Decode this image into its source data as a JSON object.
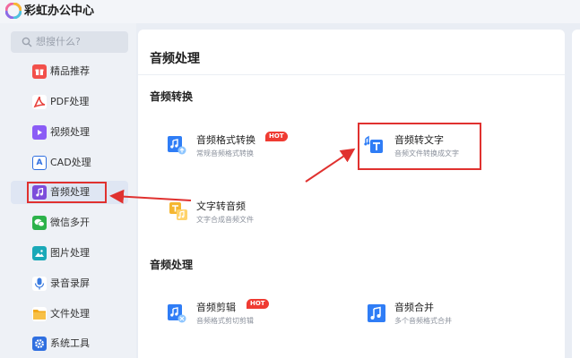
{
  "app": {
    "title": "彩虹办公中心"
  },
  "search": {
    "placeholder": "想搜什么?"
  },
  "sidebar": {
    "items": [
      {
        "label": "精品推荐",
        "icon": "gift-icon",
        "color": "#f2504b"
      },
      {
        "label": "PDF处理",
        "icon": "pdf-icon",
        "color": "#e8413c"
      },
      {
        "label": "视频处理",
        "icon": "video-icon",
        "color": "#8b5cf6"
      },
      {
        "label": "CAD处理",
        "icon": "cad-icon",
        "color": "#2f6fe0"
      },
      {
        "label": "音频处理",
        "icon": "music-icon",
        "color": "#7c4ddb"
      },
      {
        "label": "微信多开",
        "icon": "wechat-icon",
        "color": "#2cb24a"
      },
      {
        "label": "图片处理",
        "icon": "image-icon",
        "color": "#1aa9b8"
      },
      {
        "label": "录音录屏",
        "icon": "microphone-icon",
        "color": "#3a7be0"
      },
      {
        "label": "文件处理",
        "icon": "folder-icon",
        "color": "#f2a91b"
      },
      {
        "label": "系统工具",
        "icon": "settings-icon",
        "color": "#2f6fe0"
      }
    ],
    "active_index": 4
  },
  "main": {
    "title": "音频处理",
    "sections": [
      {
        "title": "音频转换",
        "tools": [
          {
            "title": "音频格式转换",
            "desc": "常规音频格式转换",
            "badge": "HOT",
            "icon": "audio-convert-icon"
          },
          {
            "title": "音频转文字",
            "desc": "音频文件转换成文字",
            "badge": "",
            "icon": "audio-to-text-icon"
          },
          {
            "title": "文字转音频",
            "desc": "文字合成音频文件",
            "badge": "",
            "icon": "text-to-audio-icon"
          }
        ]
      },
      {
        "title": "音频处理",
        "tools": [
          {
            "title": "音频剪辑",
            "desc": "音频格式剪切剪辑",
            "badge": "HOT",
            "icon": "audio-cut-icon"
          },
          {
            "title": "音频合并",
            "desc": "多个音频格式合并",
            "badge": "",
            "icon": "audio-merge-icon"
          }
        ]
      }
    ]
  },
  "colors": {
    "accent": "#2f7df6",
    "annotation": "#e0312f",
    "hot": "#ef3b32"
  }
}
